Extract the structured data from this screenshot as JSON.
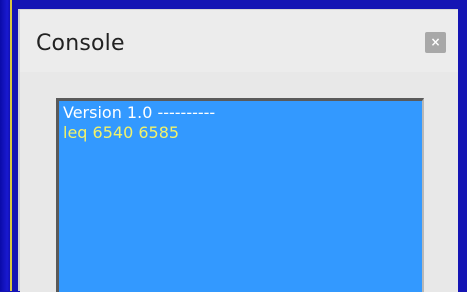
{
  "window": {
    "title": "Console",
    "close_glyph": "×"
  },
  "console": {
    "lines": [
      {
        "text": "Version 1.0 ----------",
        "color": "#ffffff"
      },
      {
        "text": "leq 6540 6585",
        "color": "#f2f26a"
      }
    ],
    "background": "#3399ff"
  },
  "colors": {
    "desktop": "#1414b4",
    "window_bg": "#ececec",
    "close_button": "#a8a8a8"
  },
  "icons": {
    "close": "close-icon"
  }
}
